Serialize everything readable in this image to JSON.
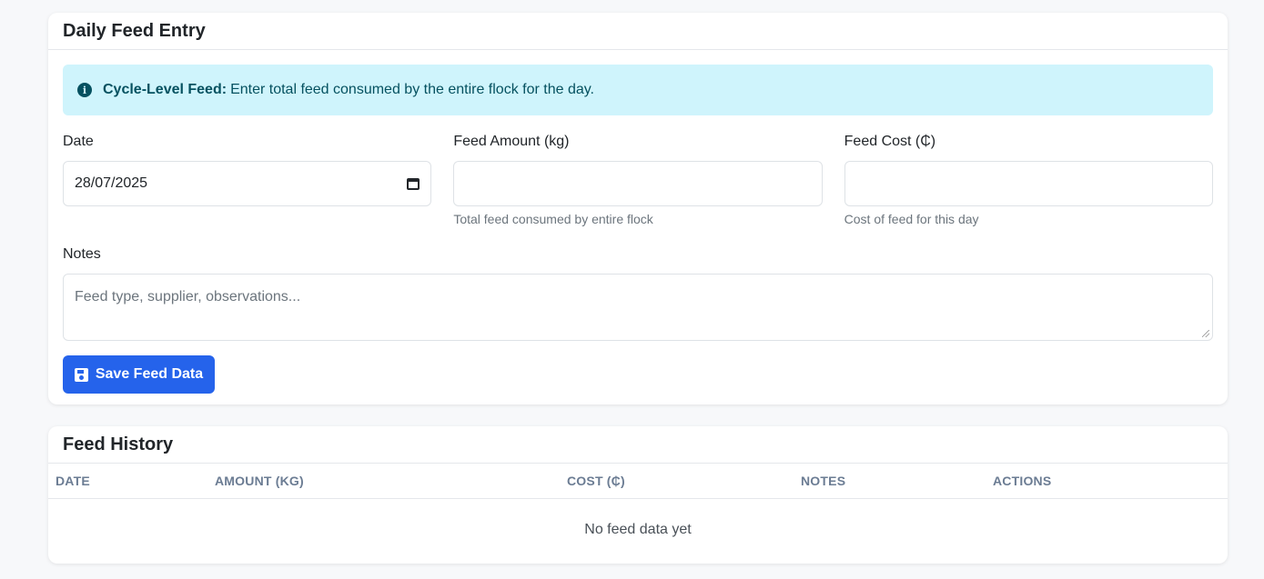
{
  "entry": {
    "title": "Daily Feed Entry",
    "alert": {
      "icon": "info-icon",
      "strong": "Cycle-Level Feed:",
      "text": "Enter total feed consumed by the entire flock for the day."
    },
    "fields": {
      "date": {
        "label": "Date",
        "value": "28/07/2025"
      },
      "amount": {
        "label": "Feed Amount (kg)",
        "value": "",
        "help": "Total feed consumed by entire flock"
      },
      "cost": {
        "label": "Feed Cost (₵)",
        "value": "",
        "help": "Cost of feed for this day"
      },
      "notes": {
        "label": "Notes",
        "placeholder": "Feed type, supplier, observations..."
      }
    },
    "save_label": "Save Feed Data",
    "save_icon": "save-icon"
  },
  "history": {
    "title": "Feed History",
    "columns": [
      "Date",
      "Amount (kg)",
      "Cost (₵)",
      "Notes",
      "Actions"
    ],
    "empty_text": "No feed data yet"
  },
  "colors": {
    "primary": "#2563eb",
    "alert_bg": "#cff4fc",
    "alert_text": "#055160",
    "page_bg": "#f7f8fa"
  }
}
